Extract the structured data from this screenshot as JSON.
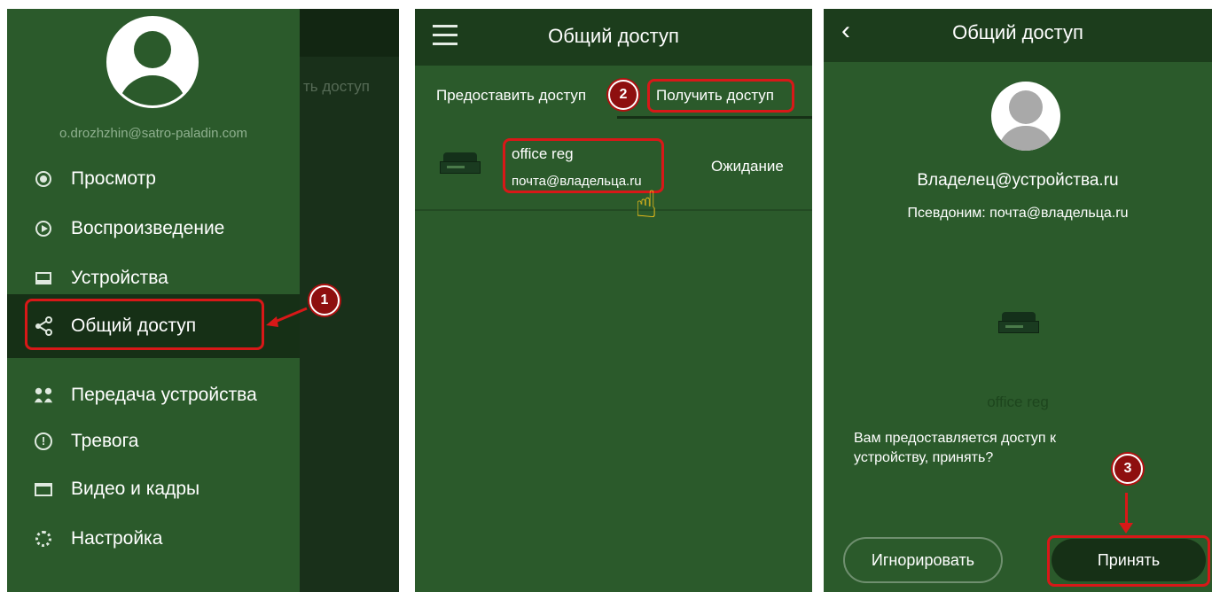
{
  "panel1": {
    "behind_text": "ть доступ",
    "email": "o.drozhzhin@satro-paladin.com",
    "menu": [
      {
        "label": "Просмотр",
        "icon": "view-icon"
      },
      {
        "label": "Воспроизведение",
        "icon": "playback-icon"
      },
      {
        "label": "Устройства",
        "icon": "devices-icon"
      },
      {
        "label": "Общий доступ",
        "icon": "share-icon"
      },
      {
        "label": "Передача устройства",
        "icon": "transfer-icon"
      },
      {
        "label": "Тревога",
        "icon": "alarm-icon"
      },
      {
        "label": "Видео и кадры",
        "icon": "folder-icon"
      },
      {
        "label": "Настройка",
        "icon": "settings-icon"
      }
    ],
    "badge": "1"
  },
  "panel2": {
    "title": "Общий доступ",
    "tabs": [
      "Предоставить доступ",
      "Получить доступ"
    ],
    "badge": "2",
    "device": {
      "name": "office reg",
      "owner": "почта@владельца.ru",
      "status": "Ожидание"
    }
  },
  "panel3": {
    "title": "Общий доступ",
    "owner": "Владелец@устройства.ru",
    "alias": "Псевдоним: почта@владельца.ru",
    "device_name": "office reg",
    "message": "Вам предоставляется доступ к устройству, принять?",
    "ignore_label": "Игнорировать",
    "accept_label": "Принять",
    "badge": "3"
  },
  "colors": {
    "primary": "#2b5a2b",
    "dark": "#163016",
    "highlight": "#d81818",
    "badge": "#8e0f0f"
  }
}
